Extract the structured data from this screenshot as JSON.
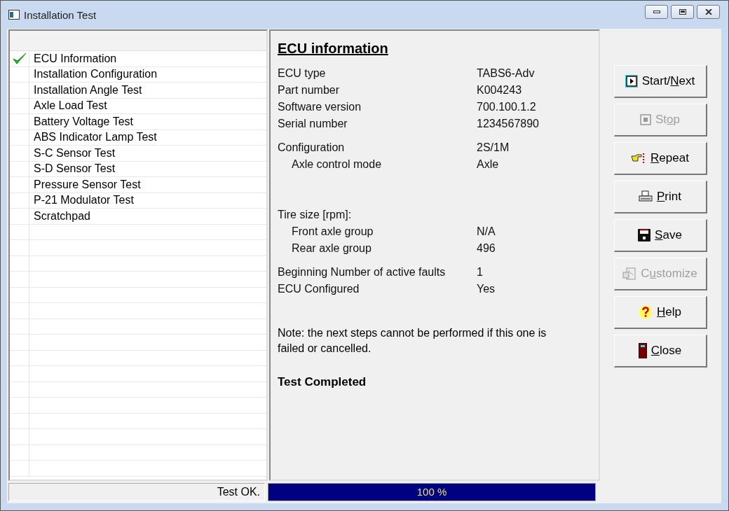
{
  "window": {
    "title": "Installation Test"
  },
  "steps": [
    {
      "label": "ECU Information",
      "done": true
    },
    {
      "label": "Installation Configuration",
      "done": false
    },
    {
      "label": "Installation Angle Test",
      "done": false
    },
    {
      "label": "Axle Load Test",
      "done": false
    },
    {
      "label": "Battery Voltage Test",
      "done": false
    },
    {
      "label": "ABS Indicator Lamp Test",
      "done": false
    },
    {
      "label": "S-C Sensor Test",
      "done": false
    },
    {
      "label": "S-D Sensor Test",
      "done": false
    },
    {
      "label": "Pressure Sensor Test",
      "done": false
    },
    {
      "label": "P-21 Modulator Test",
      "done": false
    },
    {
      "label": "Scratchpad",
      "done": false
    }
  ],
  "info": {
    "title": "ECU information",
    "groups": [
      {
        "rows": [
          {
            "label": "ECU type",
            "value": "TABS6-Adv",
            "indented": false
          },
          {
            "label": "Part number",
            "value": "K004243",
            "indented": false
          },
          {
            "label": "Software version",
            "value": "700.100.1.2",
            "indented": false
          },
          {
            "label": "Serial number",
            "value": "1234567890",
            "indented": false
          }
        ]
      },
      {
        "rows": [
          {
            "label": "Configuration",
            "value": "2S/1M",
            "indented": false
          },
          {
            "label": "Axle control mode",
            "value": "Axle",
            "indented": true
          }
        ]
      },
      {
        "rows": [
          {
            "label": "Tire size [rpm]:",
            "indented": false
          },
          {
            "label": "Front axle group",
            "value": "N/A",
            "indented": true
          },
          {
            "label": "Rear axle group",
            "value": "496",
            "indented": true
          }
        ]
      },
      {
        "rows": [
          {
            "label": "Beginning Number of active faults",
            "value": "1",
            "indented": false
          },
          {
            "label": "ECU Configured",
            "value": "Yes",
            "indented": false
          }
        ]
      }
    ],
    "note": "Note: the next steps cannot be performed if this one is failed or cancelled.",
    "result": "Test Completed"
  },
  "buttons": [
    {
      "kind": "play",
      "label_start": "Start/",
      "access_key": "N",
      "label_end": "ext",
      "disabled": false
    },
    {
      "kind": "stop",
      "label_start": "St",
      "access_key": "o",
      "label_end": "p",
      "disabled": true
    },
    {
      "kind": "repeat",
      "access_key": "R",
      "label_end": "epeat",
      "disabled": false
    },
    {
      "kind": "print",
      "access_key": "P",
      "label_end": "rint",
      "disabled": false
    },
    {
      "kind": "save",
      "access_key": "S",
      "label_end": "ave",
      "disabled": false
    },
    {
      "kind": "customize",
      "label_start": "C",
      "access_key": "u",
      "label_end": "stomize",
      "disabled": true
    },
    {
      "kind": "help",
      "access_key": "H",
      "label_end": "elp",
      "disabled": false
    },
    {
      "kind": "close",
      "access_key": "C",
      "label_end": "lose",
      "disabled": false
    }
  ],
  "status_bar": {
    "message": "Test OK.",
    "progress": {
      "level": 1,
      "text": "100 %"
    }
  }
}
